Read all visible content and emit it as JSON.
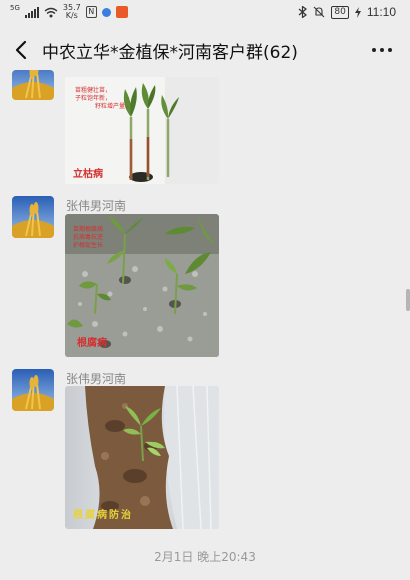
{
  "status_bar": {
    "network": "5G",
    "speed_value": "35.7",
    "speed_unit": "K/s",
    "battery": "80",
    "time": "11:10",
    "icons": [
      "signal-icon",
      "wifi-icon",
      "nfc-icon",
      "app-notify-icon",
      "bluetooth-icon",
      "mute-icon",
      "battery-icon",
      "charging-icon"
    ]
  },
  "header": {
    "title": "中农立华*金植保*河南客户群(62)"
  },
  "messages": [
    {
      "sender": "",
      "image": {
        "subject": "seedlings",
        "caption_lines": [
          "苗粗健壮苗，",
          "子粒饱年新，",
          "籽粒增产量。"
        ],
        "stamp": "立枯病"
      }
    },
    {
      "sender": "张伟男河南",
      "image": {
        "subject": "plant-field",
        "caption_lines": [
          "苗期根腐病",
          "抗病毒抗逆",
          "护根促生长"
        ],
        "stamp": "根腐病"
      }
    },
    {
      "sender": "张伟男河南",
      "image": {
        "subject": "soil-seedling",
        "caption_lines": [],
        "stamp": "根腐病防治"
      }
    }
  ],
  "timestamp": "2月1日 晚上20:43",
  "colors": {
    "background": "#ededed",
    "stamp_red": "#d43030",
    "stamp_yellow": "#e8d23a"
  }
}
